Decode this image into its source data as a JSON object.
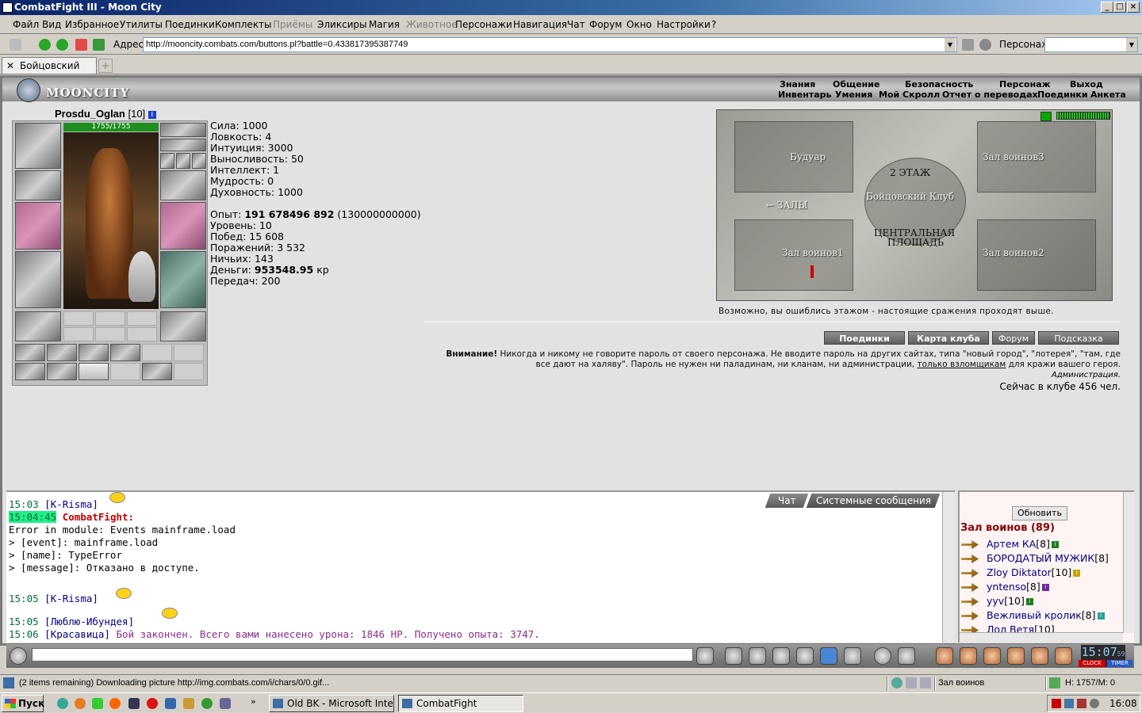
{
  "window": {
    "title": "CombatFight III - Moon City"
  },
  "menu": [
    "Файл",
    "Вид",
    "Избранное",
    "Утилиты",
    "Поединки",
    "Комплекты",
    "Приёмы",
    "Эликсиры",
    "Магия",
    "Животное",
    "Персонажи",
    "Навигация",
    "Чат",
    "Форум",
    "Окно",
    "Настройки",
    "?"
  ],
  "menu_disabled": [
    "Приёмы",
    "Животное"
  ],
  "address": {
    "label": "Адрес:",
    "url": "http://mooncity.combats.com/buttons.pl?battle=0.433817395387749",
    "char_label": "Персонаж:"
  },
  "tab": {
    "label": "Бойцовский клуб"
  },
  "game": {
    "logo": "MOONCITY",
    "nav_top": [
      "Знания",
      "Общение",
      "Безопасность",
      "Персонаж",
      "Выход"
    ],
    "nav_bottom": [
      "Инвентарь",
      "Умения",
      "Мой Скролл",
      "Отчет о переводах",
      "Поединки",
      "Анкета"
    ],
    "char": {
      "name": "Prosdu_Oglan",
      "level": "[10]",
      "hp": "1755/1755"
    },
    "stats": {
      "str": "Сила: 1000",
      "agi": "Ловкость: 4",
      "int_": "Интуиция: 3000",
      "end": "Выносливость: 50",
      "intel": "Интеллект: 1",
      "wis": "Мудрость: 0",
      "spir": "Духовность: 1000",
      "exp_label": "Опыт: ",
      "exp": "191 678496 892",
      "exp_next": "(130000000000)",
      "level": "Уровень: 10",
      "wins": "Побед: 15 608",
      "losses": "Поражений: 3 532",
      "draws": "Ничьих: 143",
      "money_label": "Деньги: ",
      "money": "953548.95",
      "money_unit": "кр",
      "transfers": "Передач: 200"
    },
    "map": {
      "floor": "2 ЭТАЖ",
      "boudoir": "Будуар",
      "hall3": "Зал воинов3",
      "club": "Бойцовский Клуб",
      "halls": "← ЗАЛЫ",
      "square1": "ЦЕНТРАЛЬНАЯ",
      "square2": "ПЛОЩАДЬ",
      "hall1": "Зал воинов1",
      "hall2": "Зал воинов2",
      "error": "Возможно, вы ошиблись этажом - настоящие сражения проходят выше."
    },
    "buttons": {
      "fights": "Поединки",
      "club_map": "Карта клуба",
      "forum": "Форум",
      "hint": "Подсказка"
    },
    "warning": {
      "bold": "Внимание!",
      "line1": " Никогда и никому не говорите пароль от своего персонажа. Не вводите пароль на других сайтах, типа \"новый город\", \"лотерея\", \"там, где",
      "line2a": "все дают на халяву\". Пароль не нужен ни паладинам, ни кланам, ни администрации, ",
      "link": "только взломщикам",
      "line2b": " для кражи вашего героя.",
      "admin": "Администрация."
    },
    "online_count": "Сейчас в клубе 456 чел."
  },
  "chat": {
    "tab_chat": "Чат",
    "tab_sys": "Системные сообщения",
    "lines": [
      {
        "time": "15:03",
        "nick": "[K-Risma]"
      },
      {
        "time": "15:04:45",
        "nick": "CombatFight:"
      },
      {
        "text": "Error in module: Events mainframe.load"
      },
      {
        "text": "> [event]: mainframe.load"
      },
      {
        "text": "> [name]: TypeError"
      },
      {
        "text": "> [message]: Отказано в доступе."
      },
      {
        "time": "15:05",
        "nick": "[K-Risma]"
      },
      {
        "time": "15:05",
        "nick": "[Люблю-Ибундея]"
      },
      {
        "time": "15:06",
        "nick": "[Красавица]",
        "msg": "Бой закончен. Всего вами нанесено урона: 1846 HP. Получено опыта: 3747."
      }
    ]
  },
  "online": {
    "refresh": "Обновить",
    "room": "Зал воинов (89)",
    "users": [
      {
        "name": "Артем КА",
        "lvl": "[8]"
      },
      {
        "name": "БОРОДАТЫЙ МУЖИК",
        "lvl": "[8]"
      },
      {
        "name": "Zloy Diktator",
        "lvl": "[10]"
      },
      {
        "name": "yntenso",
        "lvl": "[8]"
      },
      {
        "name": "yyv",
        "lvl": "[10]"
      },
      {
        "name": "Вежливый кролик",
        "lvl": "[8]"
      },
      {
        "name": "Лол Ветя",
        "lvl": "[10]"
      }
    ]
  },
  "toolbar": {
    "clock": "15:07",
    "clock_sec": "59",
    "clock_label": "CLOCK",
    "timer_label": "TIMER"
  },
  "statusbar": {
    "text": "(2 items remaining) Downloading picture http://img.combats.com/i/chars/0/0.gif...",
    "location": "Зал воинов",
    "hp": "H: 1757/M: 0"
  },
  "taskbar": {
    "start": "Пуск",
    "task1": "Old BK - Microsoft Intern...",
    "task2": "CombatFight",
    "time": "16:08"
  }
}
